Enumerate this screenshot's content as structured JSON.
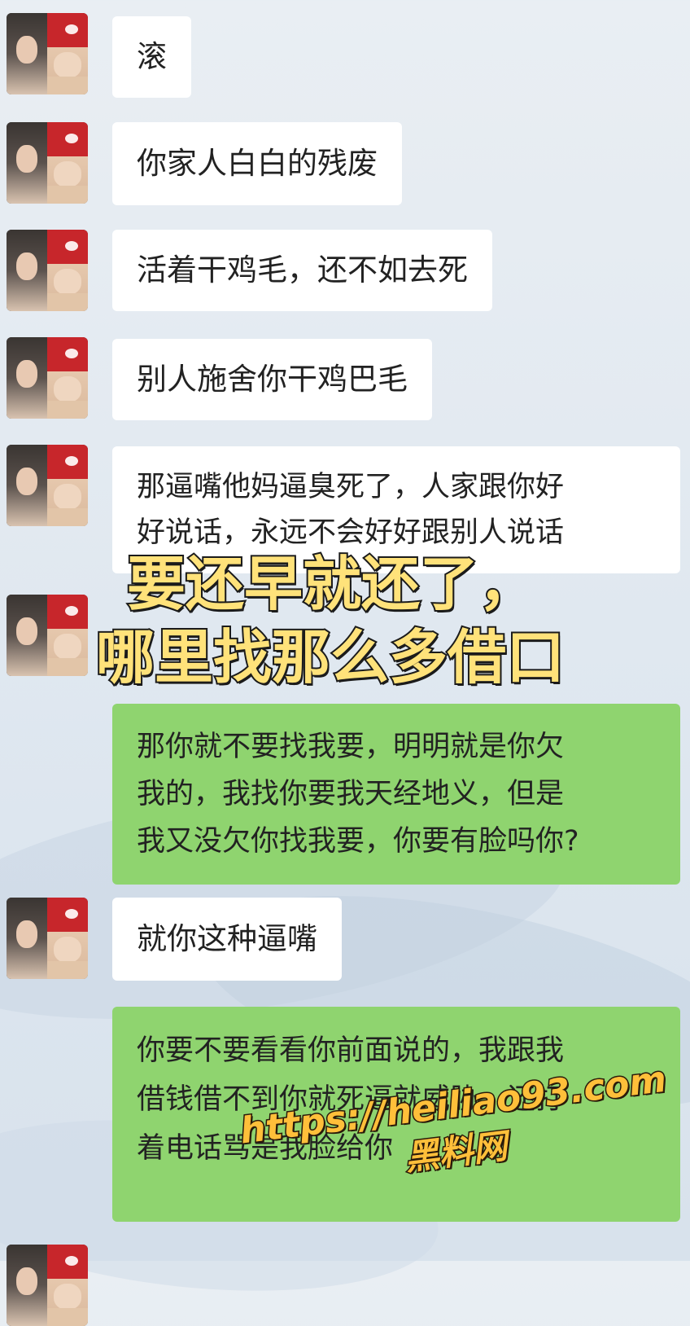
{
  "messages": [
    {
      "side": "incoming",
      "text": "滚"
    },
    {
      "side": "incoming",
      "text": "你家人白白的残废"
    },
    {
      "side": "incoming",
      "text": "活着干鸡毛，还不如去死"
    },
    {
      "side": "incoming",
      "text": "别人施舍你干鸡巴毛"
    },
    {
      "side": "incoming",
      "text": "那逼嘴他妈逼臭死了，人家跟你好\n好说话，永远不会好好跟别人说话"
    },
    {
      "side": "outgoing",
      "text": "那你就不要找我要，明明就是你欠\n我的，我找你要我天经地义，但是\n我又没欠你找我要，你要有脸吗你?"
    },
    {
      "side": "incoming",
      "text": "就你这种逼嘴"
    },
    {
      "side": "outgoing",
      "text": "你要不要看看你前面说的，我跟我\n借钱借不到你就死逼就威胁，还打\n着电话骂是我脸给你"
    }
  ],
  "overlay_caption": {
    "line1": "要还早就还了，",
    "line2": "哪里找那么多借口"
  },
  "watermark": {
    "url": "https://heiliao93.com",
    "name": "黑料网"
  },
  "colors": {
    "incoming_bubble": "#ffffff",
    "outgoing_bubble": "#8fd46f",
    "caption_fill": "#ffe27a",
    "watermark_fill": "#ffbf3a"
  }
}
